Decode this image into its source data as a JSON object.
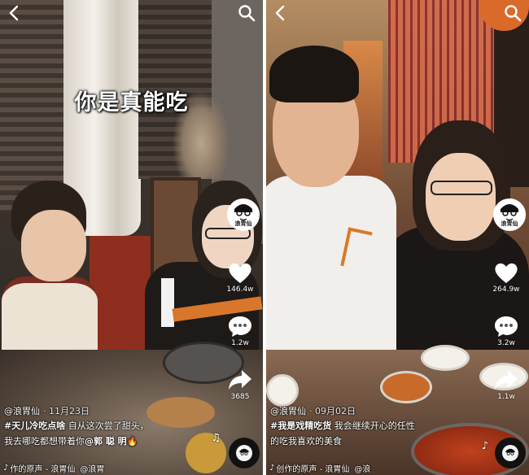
{
  "panels": [
    {
      "caption": "你是真能吃",
      "avatar_tag": "浪胃仙",
      "likes": "146.4w",
      "comments": "1.2w",
      "shares": "3685",
      "author": "@浪胃仙",
      "date": "· 11月23日",
      "desc_tag": "#天儿冷吃点啥",
      "desc_text": " 自从这次尝了甜头，",
      "desc_text2": "我去哪吃都想带着你",
      "desc_mention": "@郭 聪 明",
      "music_label": "作的原声 - 浪胃仙",
      "music_user": "@浪胃",
      "fire_emoji": "🔥"
    },
    {
      "avatar_tag": "浪胃仙",
      "likes": "264.9w",
      "comments": "3.2w",
      "shares": "1.1w",
      "author": "@浪胃仙",
      "date": "· 09月02日",
      "desc_tag": "#我是戏精吃货",
      "desc_text": " 我会继续开心的任性",
      "desc_text2": "的吃我喜欢的美食",
      "music_label": "创作的原声 - 浪胃仙",
      "music_user": "@浪"
    }
  ],
  "icons": {
    "back": "back-arrow-icon",
    "search": "search-icon",
    "like": "heart-icon",
    "comment": "comment-bubble-icon",
    "share": "share-arrow-icon",
    "music": "music-note-icon"
  }
}
